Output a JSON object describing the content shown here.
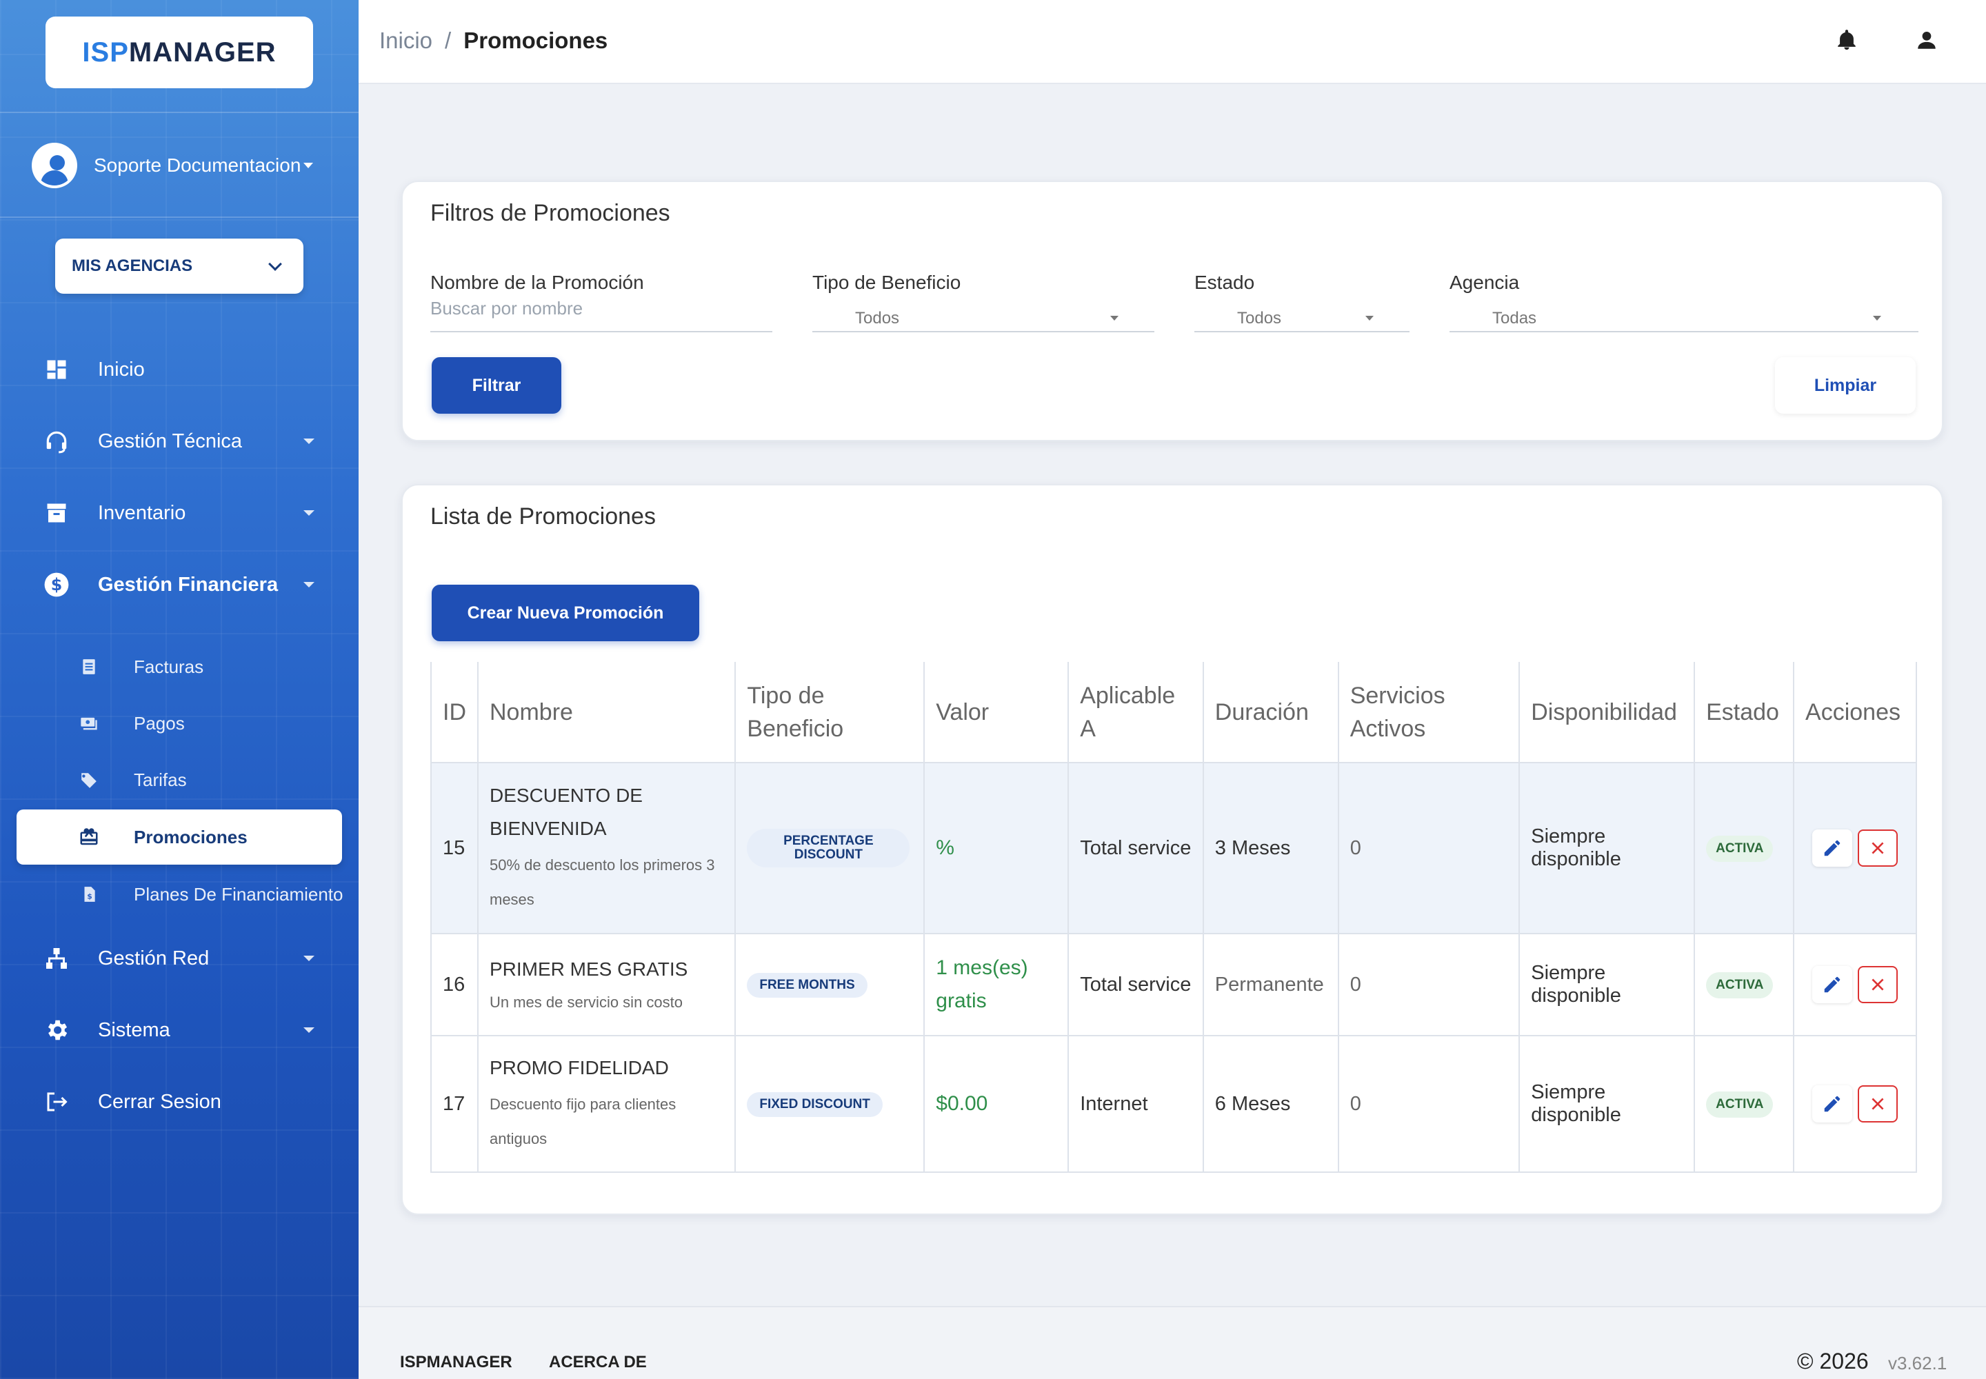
{
  "brand": {
    "part1": "ISP",
    "part2": "MANAGER"
  },
  "user": {
    "name": "Soporte Documentacion"
  },
  "agency_button": {
    "label": "MIS AGENCIAS"
  },
  "nav": {
    "inicio": "Inicio",
    "gestion_tecnica": "Gestión Técnica",
    "inventario": "Inventario",
    "gestion_financiera": "Gestión Financiera",
    "sub": {
      "facturas": "Facturas",
      "pagos": "Pagos",
      "tarifas": "Tarifas",
      "promociones": "Promociones",
      "planes": "Planes De Financiamiento"
    },
    "gestion_red": "Gestión Red",
    "sistema": "Sistema",
    "cerrar": "Cerrar Sesion"
  },
  "breadcrumb": {
    "home": "Inicio",
    "separator": "/",
    "current": "Promociones"
  },
  "filters": {
    "title": "Filtros de Promociones",
    "nombre": {
      "label": "Nombre de la Promoción",
      "placeholder": "Buscar por nombre"
    },
    "tipo": {
      "label": "Tipo de Beneficio",
      "value": "Todos"
    },
    "estado": {
      "label": "Estado",
      "value": "Todos"
    },
    "agencia": {
      "label": "Agencia",
      "value": "Todas"
    },
    "filtrar": "Filtrar",
    "limpiar": "Limpiar"
  },
  "list": {
    "title": "Lista de Promociones",
    "create_button": "Crear Nueva Promoción",
    "columns": [
      "ID",
      "Nombre",
      "Tipo de Beneficio",
      "Valor",
      "Aplicable A",
      "Duración",
      "Servicios Activos",
      "Disponibilidad",
      "Estado",
      "Acciones"
    ],
    "rows": [
      {
        "id": "15",
        "name": "DESCUENTO DE BIENVENIDA",
        "desc": "50% de descuento los primeros 3 meses",
        "tipo": "PERCENTAGE DISCOUNT",
        "valor": "%",
        "aplicable": "Total service",
        "duracion": "3 Meses",
        "servicios": "0",
        "disponibilidad": "Siempre disponible",
        "estado": "ACTIVA"
      },
      {
        "id": "16",
        "name": "PRIMER MES GRATIS",
        "desc": "Un mes de servicio sin costo",
        "tipo": "FREE MONTHS",
        "valor": "1 mes(es) gratis",
        "aplicable": "Total service",
        "duracion": "Permanente",
        "servicios": "0",
        "disponibilidad": "Siempre disponible",
        "estado": "ACTIVA"
      },
      {
        "id": "17",
        "name": "PROMO FIDELIDAD",
        "desc": "Descuento fijo para clientes antiguos",
        "tipo": "FIXED DISCOUNT",
        "valor": "$0.00",
        "aplicable": "Internet",
        "duracion": "6 Meses",
        "servicios": "0",
        "disponibilidad": "Siempre disponible",
        "estado": "ACTIVA"
      }
    ]
  },
  "footer": {
    "link1": "ISPMANAGER",
    "link2": "ACERCA DE",
    "copyright": "© 2026",
    "version": "v3.62.1"
  },
  "colors": {
    "primary": "#1f4fb5",
    "sidebar_top": "#4a90dc",
    "sidebar_bottom": "#1a48a8",
    "success": "#2f8f4a",
    "danger": "#dd3333"
  }
}
